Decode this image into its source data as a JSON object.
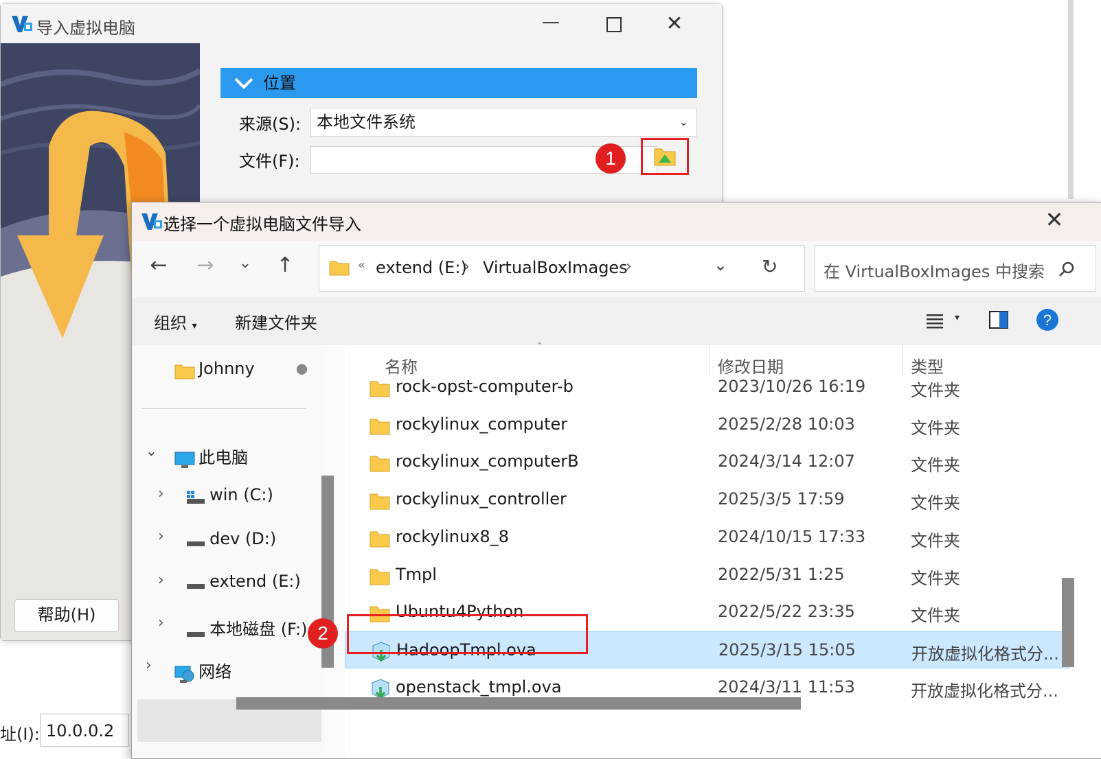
{
  "background": {
    "address_label": "址(I):",
    "address_value": "10.0.0.2"
  },
  "import_dialog": {
    "title": "导入虚拟电脑",
    "section_title": "位置",
    "source_label": "来源(S):",
    "source_value": "本地文件系统",
    "file_label": "文件(F):",
    "file_value": "",
    "help_button": "帮助(H)",
    "step1_badge": "1"
  },
  "file_dialog": {
    "title": "选择一个虚拟电脑文件导入",
    "address": {
      "overflow": "«",
      "crumbs": [
        "extend (E:)",
        "VirtualBoxImages"
      ]
    },
    "search_placeholder": "在 VirtualBoxImages 中搜索",
    "toolbar": {
      "organize": "组织",
      "new_folder": "新建文件夹"
    },
    "nav": {
      "pinned": "Johnny",
      "this_pc": "此电脑",
      "drives": [
        "win (C:)",
        "dev (D:)",
        "extend (E:)",
        "本地磁盘 (F:)"
      ],
      "network": "网络"
    },
    "columns": {
      "name": "名称",
      "date": "修改日期",
      "type": "类型"
    },
    "rows": [
      {
        "name": "rock-opst-computer-b",
        "date": "2023/10/26 16:19",
        "type": "文件夹",
        "icon": "folder-icon"
      },
      {
        "name": "rockylinux_computer",
        "date": "2025/2/28 10:03",
        "type": "文件夹",
        "icon": "folder-icon"
      },
      {
        "name": "rockylinux_computerB",
        "date": "2024/3/14 12:07",
        "type": "文件夹",
        "icon": "folder-icon"
      },
      {
        "name": "rockylinux_controller",
        "date": "2025/3/5 17:59",
        "type": "文件夹",
        "icon": "folder-icon"
      },
      {
        "name": "rockylinux8_8",
        "date": "2024/10/15 17:33",
        "type": "文件夹",
        "icon": "folder-icon"
      },
      {
        "name": "Tmpl",
        "date": "2022/5/31 1:25",
        "type": "文件夹",
        "icon": "folder-icon"
      },
      {
        "name": "Ubuntu4Python",
        "date": "2022/5/22 23:35",
        "type": "文件夹",
        "icon": "folder-icon"
      },
      {
        "name": "HadoopTmpl.ova",
        "date": "2025/3/15 15:05",
        "type": "开放虚拟化格式分...",
        "icon": "ova-file-icon",
        "selected": true
      },
      {
        "name": "openstack_tmpl.ova",
        "date": "2024/3/11 11:53",
        "type": "开放虚拟化格式分...",
        "icon": "ova-file-icon"
      }
    ],
    "step2_badge": "2"
  },
  "colors": {
    "accent": "#2a9af0",
    "annotation_red": "#e52020",
    "selection": "#cce8ff",
    "folder": "#f8c94a"
  }
}
